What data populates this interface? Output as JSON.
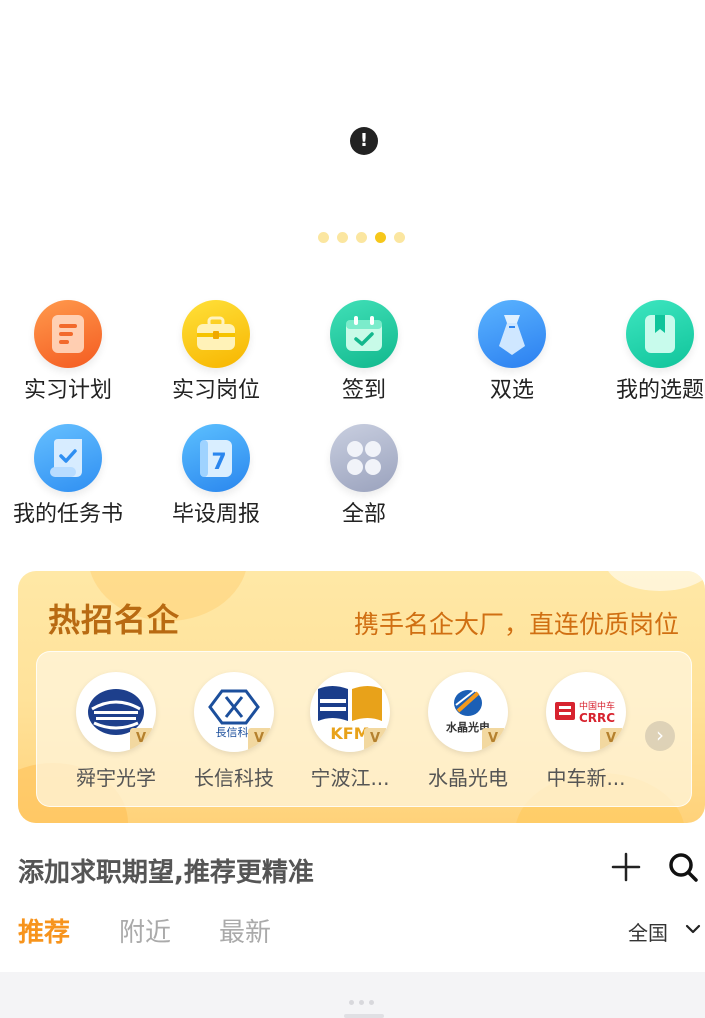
{
  "banner": {
    "alert_glyph": "!",
    "dot_count": 5,
    "active_dot": 4
  },
  "functions": [
    {
      "label": "实习计划",
      "icon": "plan-doc-icon"
    },
    {
      "label": "实习岗位",
      "icon": "briefcase-icon"
    },
    {
      "label": "签到",
      "icon": "calendar-check-icon"
    },
    {
      "label": "双选",
      "icon": "tie-icon"
    },
    {
      "label": "我的选题",
      "icon": "bookmark-book-icon"
    },
    {
      "label": "我的任务书",
      "icon": "scroll-check-icon"
    },
    {
      "label": "毕设周报",
      "icon": "calendar-7-icon"
    },
    {
      "label": "全部",
      "icon": "grid-all-icon"
    }
  ],
  "famous": {
    "title": "热招名企",
    "subtitle": "携手名企大厂，直连优质岗位",
    "verified_badge": "V",
    "companies": [
      {
        "name": "舜宇光学"
      },
      {
        "name": "长信科技",
        "logo_text": "長信科"
      },
      {
        "name": "宁波江...",
        "logo_text": "KFM"
      },
      {
        "name": "水晶光电",
        "logo_text": "水晶光电"
      },
      {
        "name": "中车新...",
        "logo_text_top": "中国中车",
        "logo_text_bottom": "CRRC"
      }
    ],
    "next_glyph": "›"
  },
  "expectation": {
    "text": "添加求职期望,推荐更精准"
  },
  "tabs": [
    {
      "label": "推荐",
      "active": true
    },
    {
      "label": "附近",
      "active": false
    },
    {
      "label": "最新",
      "active": false
    }
  ],
  "region": {
    "label": "全国"
  },
  "colors": {
    "accent": "#f7941d",
    "famous_title": "#b86a12",
    "dot_active": "#f6c71a"
  }
}
